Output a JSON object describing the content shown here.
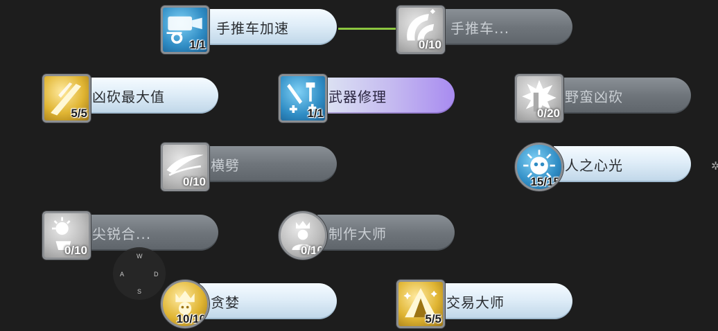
{
  "skills": [
    {
      "name": "手推车加速",
      "level": "1/1",
      "state": "active"
    },
    {
      "name": "手推车...",
      "level": "0/10",
      "state": "locked"
    },
    {
      "name": "凶砍最大值",
      "level": "5/5",
      "state": "active"
    },
    {
      "name": "武器修理",
      "level": "1/1",
      "state": "purple"
    },
    {
      "name": "野蛮凶砍",
      "level": "0/20",
      "state": "locked"
    },
    {
      "name": "横劈",
      "level": "0/10",
      "state": "locked"
    },
    {
      "name": "人之心光",
      "level": "15/15",
      "state": "active"
    },
    {
      "name": "尖锐合...",
      "level": "0/10",
      "state": "locked"
    },
    {
      "name": "制作大师",
      "level": "0/10",
      "state": "locked"
    },
    {
      "name": "贪婪",
      "level": "10/10",
      "state": "active"
    },
    {
      "name": "交易大师",
      "level": "5/5",
      "state": "active"
    }
  ],
  "icons": [
    "cart-speed-icon",
    "cart-icon",
    "slash-max-icon",
    "weapon-repair-icon",
    "savage-slash-icon",
    "cross-slash-icon",
    "heart-light-icon",
    "sharp-combine-icon",
    "craft-master-icon",
    "greed-icon",
    "trade-master-icon"
  ],
  "wasd": {
    "up": "W",
    "left": "A",
    "right": "D",
    "down": "S"
  },
  "colors": {
    "connector": "#8cc63f",
    "background": "#1d1d1d"
  }
}
